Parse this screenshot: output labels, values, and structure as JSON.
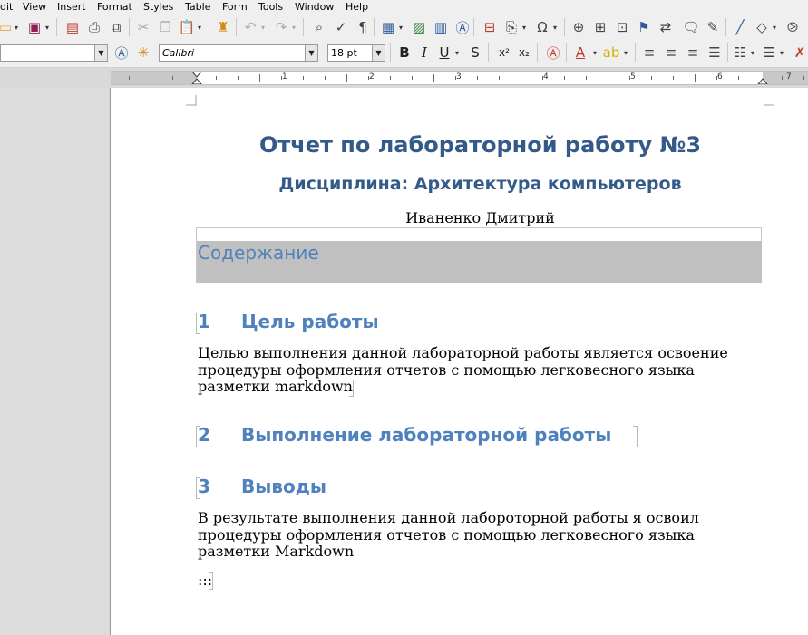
{
  "menu": [
    "dit",
    "View",
    "Insert",
    "Format",
    "Styles",
    "Table",
    "Form",
    "Tools",
    "Window",
    "Help"
  ],
  "toolbar": {
    "paragraph_style": "",
    "font_name": "Calibri",
    "font_size": "18 pt"
  },
  "ruler": {
    "numbers": [
      "1",
      "2",
      "3",
      "4",
      "5",
      "6",
      "7"
    ]
  },
  "document": {
    "title": "Отчет по лабораторной работу №3",
    "subtitle": "Дисциплина: Архитектура компьютеров",
    "author": "Иваненко Дмитрий",
    "toc_heading": "Содержание",
    "sections": [
      {
        "number": "1",
        "heading": "Цель работы",
        "body": "Целью выполнения данной лабораторной работы является освоение процедуры оформления отчетов с помощью легковесного языка разметки markdown"
      },
      {
        "number": "2",
        "heading": "Выполнение лабораторной работы",
        "body": ""
      },
      {
        "number": "3",
        "heading": "Выводы",
        "body": "В результате выполнения данной лабороторной работы я освоил процедуры оформления отчетов с помощью легковесного языка разметки Markdown"
      }
    ],
    "trailing": ":::"
  }
}
